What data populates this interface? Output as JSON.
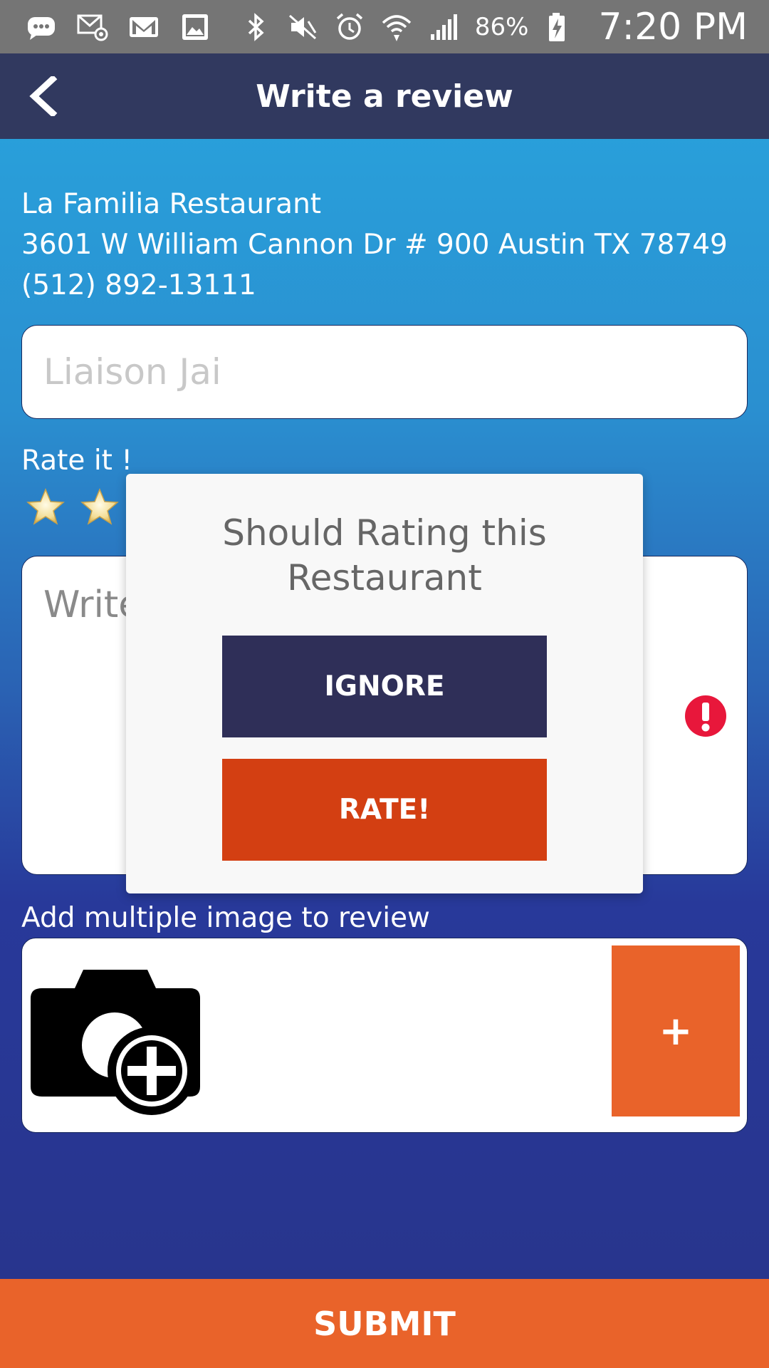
{
  "status_bar": {
    "battery_percent": "86%",
    "time": "7:20 PM",
    "icons": [
      "chat-icon",
      "email-at-icon",
      "gmail-icon",
      "image-icon",
      "bluetooth-icon",
      "mute-icon",
      "alarm-icon",
      "wifi-icon",
      "signal-icon",
      "battery-charging-icon"
    ]
  },
  "toolbar": {
    "title": "Write a review"
  },
  "restaurant": {
    "name": "La Familia Restaurant",
    "address": "3601 W William Cannon Dr # 900 Austin TX 78749",
    "phone": "(512) 892-13111"
  },
  "form": {
    "name_placeholder": "Liaison Jai",
    "rate_label": "Rate it !",
    "review_placeholder": "Write",
    "add_images_label": "Add multiple image to review",
    "add_image_button": "+",
    "submit_label": "SUBMIT"
  },
  "dialog": {
    "title_line1": "Should Rating this",
    "title_line2": "Restaurant",
    "ignore_label": "IGNORE",
    "rate_label": "RATE!"
  },
  "colors": {
    "toolbar": "#31395f",
    "accent_orange": "#e9632a",
    "rate_button": "#d33f12",
    "ignore_button": "#2f2f58",
    "error_red": "#e8173b"
  }
}
